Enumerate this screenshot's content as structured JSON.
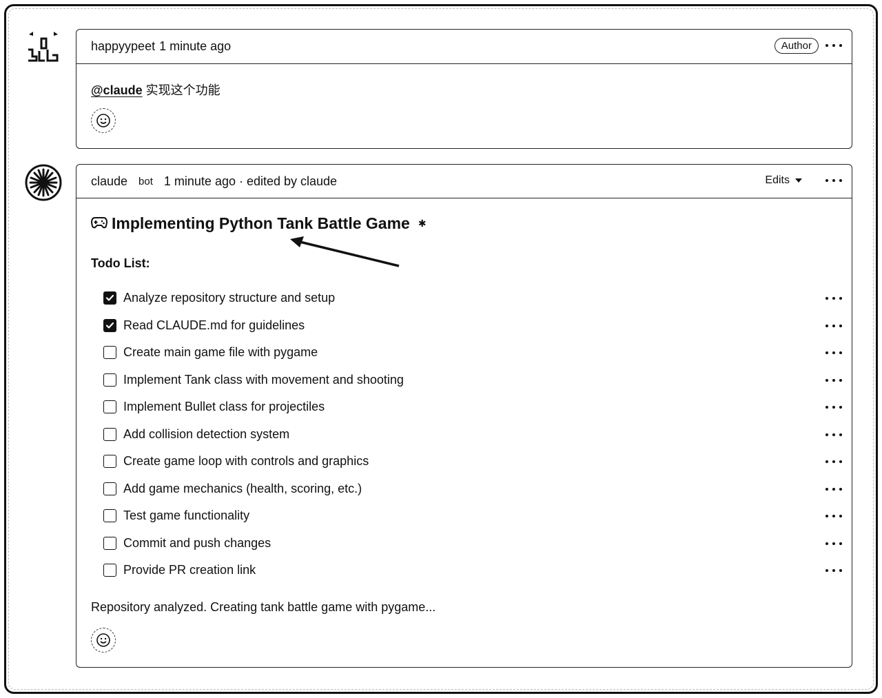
{
  "comments": [
    {
      "user": "happyypeet",
      "time": "1 minute ago",
      "badge": "Author",
      "mention": "@claude",
      "text": "实现这个功能"
    },
    {
      "user": "claude",
      "bot_label": "bot",
      "time_meta": "1 minute ago · edited by claude",
      "edits_label": "Edits",
      "heading_icon": "gamepad-icon",
      "heading": "Implementing Python Tank Battle Game",
      "todo_title": "Todo List:",
      "todos": [
        {
          "label": "Analyze repository structure and setup",
          "checked": true
        },
        {
          "label": "Read CLAUDE.md for guidelines",
          "checked": true
        },
        {
          "label": "Create main game file with pygame",
          "checked": false
        },
        {
          "label": "Implement Tank class with movement and shooting",
          "checked": false
        },
        {
          "label": "Implement Bullet class for projectiles",
          "checked": false
        },
        {
          "label": "Add collision detection system",
          "checked": false
        },
        {
          "label": "Create game loop with controls and graphics",
          "checked": false
        },
        {
          "label": "Add game mechanics (health, scoring, etc.)",
          "checked": false
        },
        {
          "label": "Test game functionality",
          "checked": false
        },
        {
          "label": "Commit and push changes",
          "checked": false
        },
        {
          "label": "Provide PR creation link",
          "checked": false
        }
      ],
      "status": "Repository analyzed. Creating tank battle game with pygame..."
    }
  ]
}
